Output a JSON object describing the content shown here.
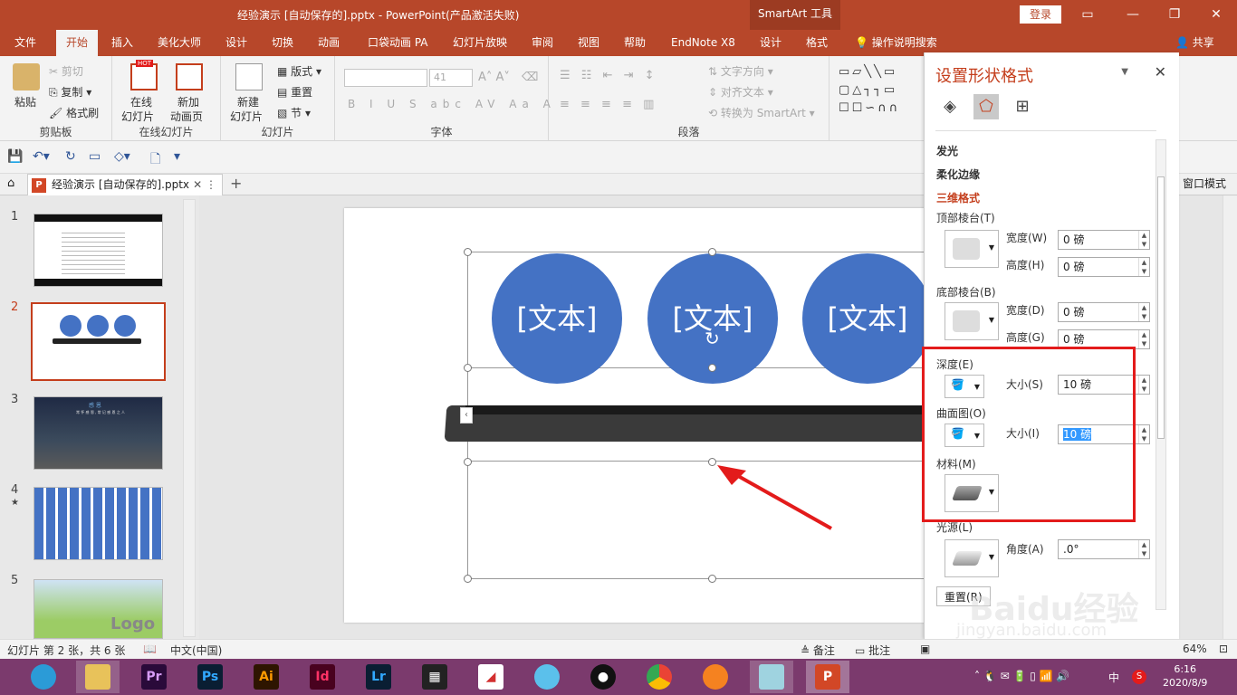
{
  "window": {
    "title": "经验演示 [自动保存的].pptx  -  PowerPoint(产品激活失败)",
    "smartart_tools": "SmartArt 工具",
    "login": "登录"
  },
  "tabs": [
    "文件",
    "开始",
    "插入",
    "美化大师",
    "设计",
    "切换",
    "动画",
    "口袋动画 PA",
    "幻灯片放映",
    "审阅",
    "视图",
    "帮助",
    "EndNote X8",
    "设计",
    "格式"
  ],
  "tell_me": "操作说明搜索",
  "share": "共享",
  "ribbon": {
    "clipboard": {
      "paste": "粘贴",
      "cut": "剪切",
      "copy": "复制",
      "format_painter": "格式刷",
      "label": "剪贴板"
    },
    "online_slides": {
      "online": "在线",
      "online2": "幻灯片",
      "new_anim": "新加",
      "new_anim2": "动画页",
      "hot": "HOT",
      "label": "在线幻灯片"
    },
    "slides": {
      "new": "新建",
      "new2": "幻灯片",
      "layout": "版式",
      "reset": "重置",
      "section": "节",
      "label": "幻灯片"
    },
    "font": {
      "size": "41",
      "label": "字体"
    },
    "paragraph": {
      "text_dir": "文字方向",
      "align_text": "对齐文本",
      "convert": "转换为 SmartArt",
      "label": "段落"
    }
  },
  "doc_tab": {
    "name": "经验演示 [自动保存的].pptx",
    "window_mode": "窗口模式"
  },
  "thumbnails": [
    {
      "num": "1"
    },
    {
      "num": "2"
    },
    {
      "num": "3",
      "text1": "感 恩",
      "text2": "常 怀 感 恩 , 常 记 感 恩 之 人"
    },
    {
      "num": "4",
      "marker": "★"
    },
    {
      "num": "5",
      "text": "Logo"
    }
  ],
  "slide": {
    "circles": [
      "[文本]",
      "[文本]",
      "[文本]"
    ]
  },
  "pane": {
    "title": "设置形状格式",
    "sections": {
      "glow": "发光",
      "soft_edges": "柔化边缘",
      "format_3d": "三维格式",
      "top_bevel": "顶部棱台(T)",
      "bottom_bevel": "底部棱台(B)",
      "depth": "深度(E)",
      "contour": "曲面图(O)",
      "material": "材料(M)",
      "lighting": "光源(L)",
      "reset": "重置(R)"
    },
    "fields": {
      "width_label": "宽度(W)",
      "width_val": "0 磅",
      "height_label": "高度(H)",
      "height_val": "0 磅",
      "width2_label": "宽度(D)",
      "width2_val": "0 磅",
      "height2_label": "高度(G)",
      "height2_val": "0 磅",
      "depth_size_label": "大小(S)",
      "depth_size_val": "10 磅",
      "contour_size_label": "大小(I)",
      "contour_size_val": "10 磅",
      "angle_label": "角度(A)",
      "angle_val": ".0°"
    }
  },
  "status": {
    "slide_info": "幻灯片 第 2 张，共 6 张",
    "language": "中文(中国)",
    "notes": "备注",
    "comments": "批注",
    "zoom": "64%"
  },
  "taskbar": {
    "apps": [
      "Pr",
      "Ps",
      "Ai",
      "Id",
      "Lr"
    ],
    "time": "6:16",
    "date": "2020/8/9",
    "ime": "中"
  },
  "watermark": {
    "brand": "Baidu经验",
    "url": "jingyan.baidu.com"
  },
  "colors": {
    "accent": "#b7472a",
    "circle": "#4472c4",
    "highlight": "#e31b1b",
    "taskbar": "#7b3a6d"
  }
}
